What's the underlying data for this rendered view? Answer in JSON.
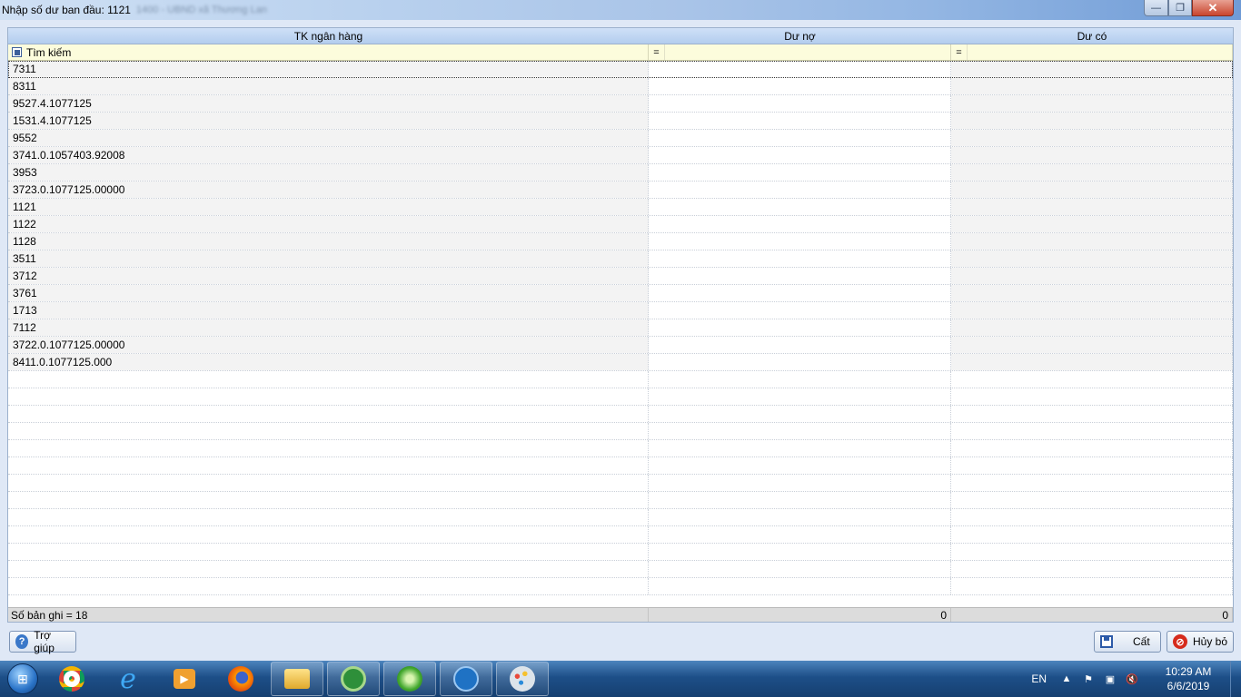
{
  "window": {
    "title": "Nhập số dư ban đầu: 1121",
    "title_suffix": "1400 - UBND xã Thương Lan",
    "controls": {
      "minimize": "—",
      "maximize": "❐",
      "close": "✕"
    }
  },
  "grid": {
    "columns": [
      "TK ngân hàng",
      "Dư nợ",
      "Dư có"
    ],
    "filter": {
      "label": "Tìm kiếm",
      "op_debit": "=",
      "op_credit": "="
    },
    "rows": [
      {
        "account": "7311",
        "debit": "",
        "credit": ""
      },
      {
        "account": "8311",
        "debit": "",
        "credit": ""
      },
      {
        "account": "9527.4.1077125",
        "debit": "",
        "credit": ""
      },
      {
        "account": "1531.4.1077125",
        "debit": "",
        "credit": ""
      },
      {
        "account": "9552",
        "debit": "",
        "credit": ""
      },
      {
        "account": "3741.0.1057403.92008",
        "debit": "",
        "credit": ""
      },
      {
        "account": "3953",
        "debit": "",
        "credit": ""
      },
      {
        "account": "3723.0.1077125.00000",
        "debit": "",
        "credit": ""
      },
      {
        "account": "1121",
        "debit": "",
        "credit": ""
      },
      {
        "account": "1122",
        "debit": "",
        "credit": ""
      },
      {
        "account": "1128",
        "debit": "",
        "credit": ""
      },
      {
        "account": "3511",
        "debit": "",
        "credit": ""
      },
      {
        "account": "3712",
        "debit": "",
        "credit": ""
      },
      {
        "account": "3761",
        "debit": "",
        "credit": ""
      },
      {
        "account": "1713",
        "debit": "",
        "credit": ""
      },
      {
        "account": "7112",
        "debit": "",
        "credit": ""
      },
      {
        "account": "3722.0.1077125.00000",
        "debit": "",
        "credit": ""
      },
      {
        "account": "8411.0.1077125.000",
        "debit": "",
        "credit": ""
      }
    ],
    "footer": {
      "record_count": "Số bản ghi = 18",
      "total_debit": "0",
      "total_credit": "0"
    }
  },
  "buttons": {
    "help": "Trợ giúp",
    "save": "Cất",
    "cancel": "Hủy bỏ"
  },
  "taskbar": {
    "icons": [
      "chrome-icon",
      "internet-explorer-icon",
      "media-player-icon",
      "firefox-icon",
      "file-explorer-icon",
      "accounting-app-icon",
      "green-app-icon",
      "remote-desktop-icon",
      "paint-icon"
    ],
    "language": "EN",
    "time": "10:29 AM",
    "date": "6/6/2019"
  },
  "colors": {
    "header_bg": "#b3cdee",
    "filter_bg": "#fcfcdc",
    "taskbar_bg": "#1d4f88",
    "close_btn": "#c9452d"
  }
}
